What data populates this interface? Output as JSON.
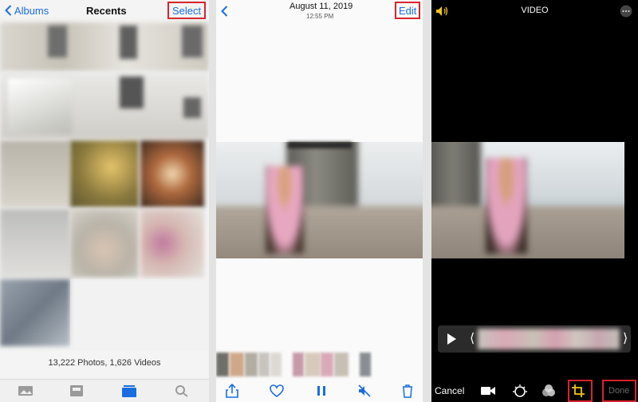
{
  "recents": {
    "back_label": "Albums",
    "title": "Recents",
    "select_label": "Select",
    "counts": "13,222 Photos, 1,626 Videos",
    "tabs": [
      "photos-icon",
      "for-you-icon",
      "albums-icon",
      "search-icon"
    ]
  },
  "viewer": {
    "date": "August 11, 2019",
    "time": "12:55 PM",
    "edit_label": "Edit",
    "toolbar": [
      "share-icon",
      "heart-icon",
      "pause-icon",
      "mute-icon",
      "trash-icon"
    ]
  },
  "editor": {
    "title": "VIDEO",
    "cancel_label": "Cancel",
    "done_label": "Done",
    "tools": [
      "video-camera-icon",
      "adjust-icon",
      "filters-icon",
      "crop-icon"
    ]
  },
  "colors": {
    "accent": "#1a6de0",
    "highlight": "#d8232a"
  }
}
